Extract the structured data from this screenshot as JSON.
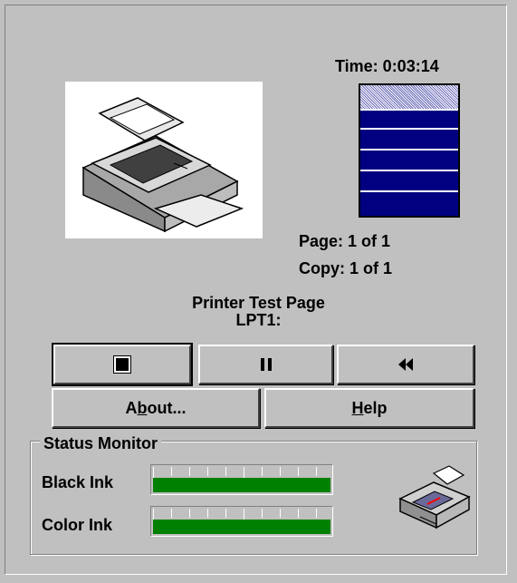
{
  "status": {
    "time_label": "Time: 0:03:14",
    "page_label": "Page: 1 of 1",
    "copy_label": "Copy: 1 of 1",
    "document_name": "Printer Test Page",
    "port": "LPT1:",
    "progress": 0.2
  },
  "controls": {
    "stop_icon": "stop-icon",
    "pause_icon": "pause-icon",
    "rewind_icon": "rewind-icon",
    "about_label": "About...",
    "help_label": "Help"
  },
  "status_monitor": {
    "title": "Status Monitor",
    "black_ink_label": "Black Ink",
    "color_ink_label": "Color Ink",
    "black_ink_level": 1.0,
    "color_ink_level": 1.0,
    "bar_color": "#008000"
  },
  "colors": {
    "background": "#c0c0c0",
    "progress_fill": "#000080"
  }
}
